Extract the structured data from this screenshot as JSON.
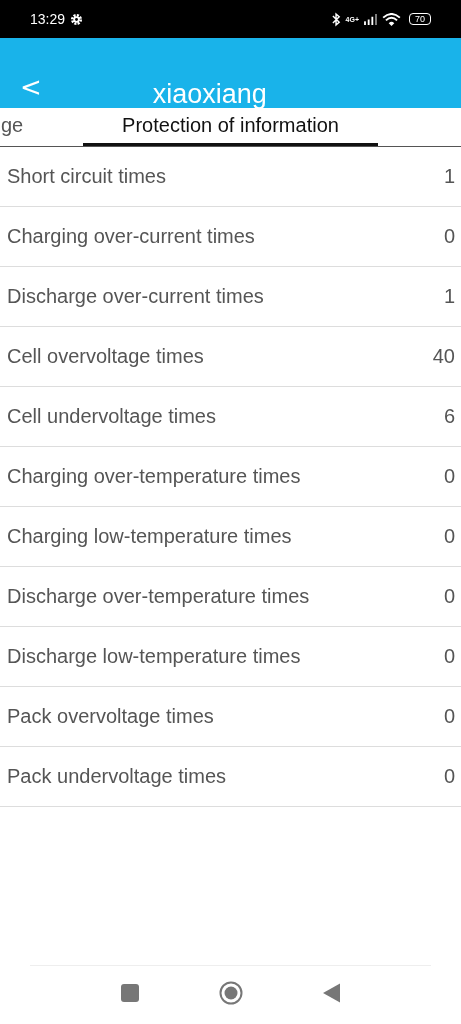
{
  "status_bar": {
    "time": "13:29",
    "network": "4G+",
    "battery": "70"
  },
  "header": {
    "back": "<",
    "title": "xiaoxiang"
  },
  "tabs": [
    {
      "label": "ge",
      "selected": false
    },
    {
      "label": "Protection of information",
      "selected": true
    }
  ],
  "rows": [
    {
      "label": "Short circuit times",
      "value": "1"
    },
    {
      "label": "Charging over-current times",
      "value": "0"
    },
    {
      "label": "Discharge over-current times",
      "value": "1"
    },
    {
      "label": "Cell overvoltage times",
      "value": "40"
    },
    {
      "label": "Cell undervoltage times",
      "value": "6"
    },
    {
      "label": "Charging over-temperature times",
      "value": "0"
    },
    {
      "label": "Charging low-temperature times",
      "value": "0"
    },
    {
      "label": "Discharge over-temperature times",
      "value": "0"
    },
    {
      "label": "Discharge low-temperature times",
      "value": "0"
    },
    {
      "label": "Pack overvoltage times",
      "value": "0"
    },
    {
      "label": "Pack undervoltage times",
      "value": "0"
    }
  ]
}
